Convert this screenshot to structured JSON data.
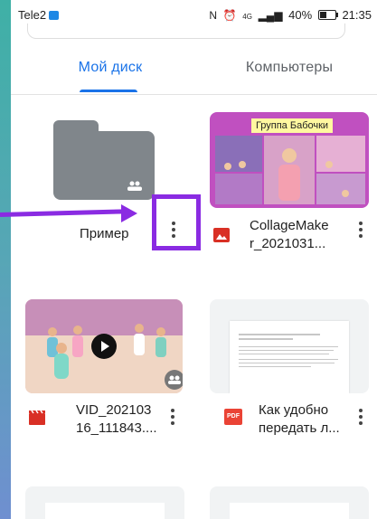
{
  "status_bar": {
    "carrier": "Tele2",
    "network": "4G",
    "battery": "40%",
    "time": "21:35"
  },
  "tabs": [
    {
      "label": "Мой диск"
    },
    {
      "label": "Компьютеры"
    }
  ],
  "files": [
    {
      "name_line1": "Пример",
      "name_line2": ""
    },
    {
      "name_line1": "CollageMake",
      "name_line2": "r_2021031..."
    },
    {
      "name_line1": "VID_202103",
      "name_line2": "16_111843...."
    },
    {
      "name_line1": "Как удобно",
      "name_line2": "передать л..."
    }
  ],
  "collage_banner": "Группа Бабочки",
  "file_type_labels": {
    "pdf": "PDF"
  },
  "colors": {
    "accent": "#1a73e8",
    "highlight": "#8a2be2",
    "image_icon": "#d93025",
    "video_icon": "#d93025",
    "pdf_icon": "#ea4335",
    "folder": "#80868b"
  }
}
